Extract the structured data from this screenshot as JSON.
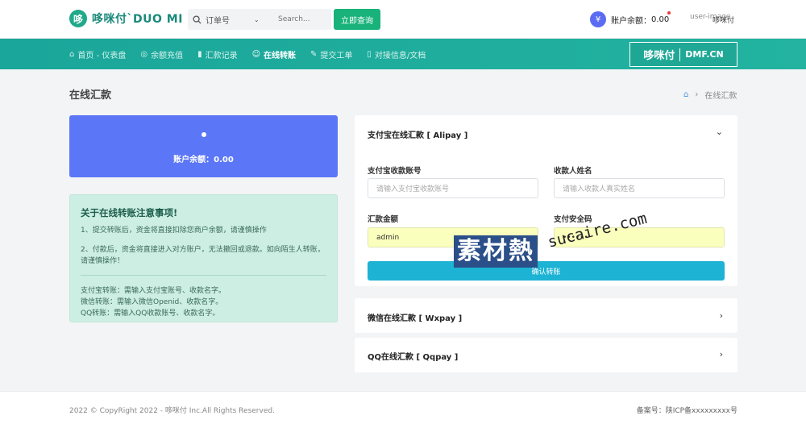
{
  "header": {
    "logo_mark": "哆",
    "logo_text": "哆咪付`DUO MI FU",
    "search_select": "订单号",
    "search_placeholder": "Search...",
    "query_button": "立即查询",
    "balance_label": "账户余额：",
    "balance_value": "0.00",
    "user_image_alt": "user-image",
    "user_name": "哆咪付"
  },
  "nav": {
    "items": [
      {
        "label": "首页 - 仪表盘",
        "icon": "home-icon"
      },
      {
        "label": "余额充值",
        "icon": "recharge-icon"
      },
      {
        "label": "汇款记录",
        "icon": "chart-icon"
      },
      {
        "label": "在线转账",
        "icon": "transfer-icon"
      },
      {
        "label": "提交工单",
        "icon": "edit-icon"
      },
      {
        "label": "对接信息/文档",
        "icon": "document-icon"
      }
    ],
    "brand_name": "哆咪付",
    "brand_domain": "DMF.CN"
  },
  "page": {
    "title": "在线汇款",
    "breadcrumb_current": "在线汇款"
  },
  "balance_card": {
    "label": "账户余额：0.00"
  },
  "notice": {
    "title": "关于在线转账注意事项!",
    "item1": "1、提交转账后，资金将直接扣除您商户余额，请谨慎操作",
    "item2": "2、付款后，资金将直接进入对方账户，无法撤回或退款。如向陌生人转账，请谨慎操作！",
    "alipay": "支付宝转账：需输入支付宝账号、收款名字。",
    "wechat": "微信转账：需输入微信Openid、收款名字。",
    "qq": "QQ转账：需输入QQ收款账号、收款名字。"
  },
  "alipay_panel": {
    "title": "支付宝在线汇款 [ Alipay ]",
    "account_label": "支付宝收款账号",
    "account_placeholder": "请输入支付宝收款账号",
    "name_label": "收款人姓名",
    "name_placeholder": "请输入收款人真实姓名",
    "amount_label": "汇款金额",
    "amount_value": "admin",
    "pwd_label": "支付安全码",
    "pwd_value": "••••••",
    "confirm_label": "确认转账"
  },
  "wechat_panel": {
    "title": "微信在线汇款 [ Wxpay ]"
  },
  "qq_panel": {
    "title": "QQ在线汇款 [ Qqpay ]"
  },
  "footer": {
    "copyright": "2022 © CopyRight 2022 - 哆咪付 Inc.All Rights Reserved.",
    "icp": "备案号：陕ICP备xxxxxxxxx号"
  },
  "watermark": {
    "text": "素材熱",
    "url": "sucaire.com"
  }
}
